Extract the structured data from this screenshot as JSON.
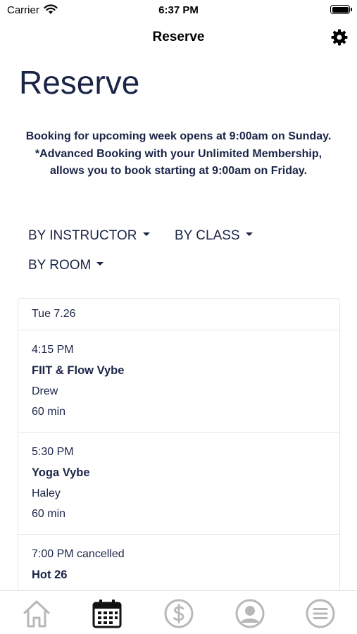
{
  "status_bar": {
    "carrier": "Carrier",
    "time": "6:37 PM"
  },
  "nav": {
    "title": "Reserve",
    "settings_icon": "gear-icon"
  },
  "page": {
    "title": "Reserve",
    "notice": "Booking for upcoming week opens at 9:00am on Sunday. *Advanced Booking with your Unlimited Membership, allows you to book starting at 9:00am on Friday."
  },
  "filters": [
    {
      "label": "BY INSTRUCTOR"
    },
    {
      "label": "BY CLASS"
    },
    {
      "label": "BY ROOM"
    }
  ],
  "schedule": {
    "day": "Tue 7.26",
    "classes": [
      {
        "time": "4:15 PM",
        "name": "FIIT & Flow Vybe",
        "instructor": "Drew",
        "duration": "60 min"
      },
      {
        "time": "5:30 PM",
        "name": "Yoga Vybe",
        "instructor": "Haley",
        "duration": "60 min"
      },
      {
        "time": "7:00 PM cancelled",
        "name": "Hot 26",
        "instructor": "",
        "duration": ""
      }
    ]
  },
  "tab_bar": {
    "tabs": [
      {
        "icon": "home-icon",
        "active": false
      },
      {
        "icon": "calendar-icon",
        "active": true
      },
      {
        "icon": "dollar-icon",
        "active": false
      },
      {
        "icon": "profile-icon",
        "active": false
      },
      {
        "icon": "menu-icon",
        "active": false
      }
    ]
  },
  "colors": {
    "primary": "#1a2447",
    "inactive_icon": "#b8b8b8",
    "border": "#e6e6e6"
  }
}
